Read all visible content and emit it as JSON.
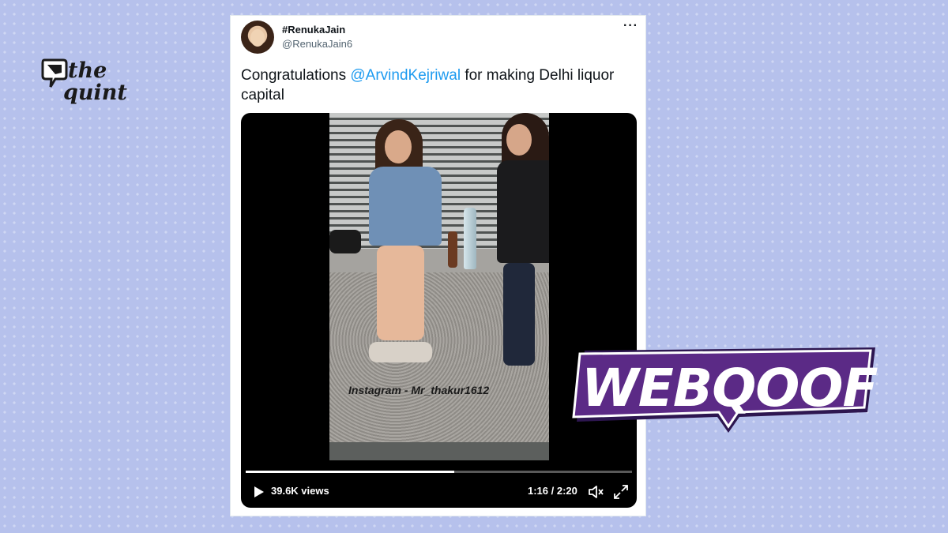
{
  "brand": {
    "line1": "the",
    "line2": "quint"
  },
  "tweet": {
    "display_name": "#RenukaJain",
    "handle": "@RenukaJain6",
    "more_label": "···",
    "text_before": "Congratulations ",
    "mention": "@ArvindKejriwal",
    "text_after": " for making Delhi liquor capital"
  },
  "video": {
    "watermark": "Instagram - Mr_thakur1612",
    "views": "39.6K views",
    "time": "1:16 / 2:20",
    "progress": 0.54
  },
  "badge": {
    "label": "WEBQOOF"
  },
  "colors": {
    "background": "#b6c1ec",
    "mention": "#1d9bf0",
    "badge_purple": "#5b2a86",
    "badge_dark": "#2d1650"
  },
  "icons": [
    "the-quint-logo-icon",
    "more-options-icon",
    "play-icon",
    "mute-icon",
    "fullscreen-icon"
  ]
}
